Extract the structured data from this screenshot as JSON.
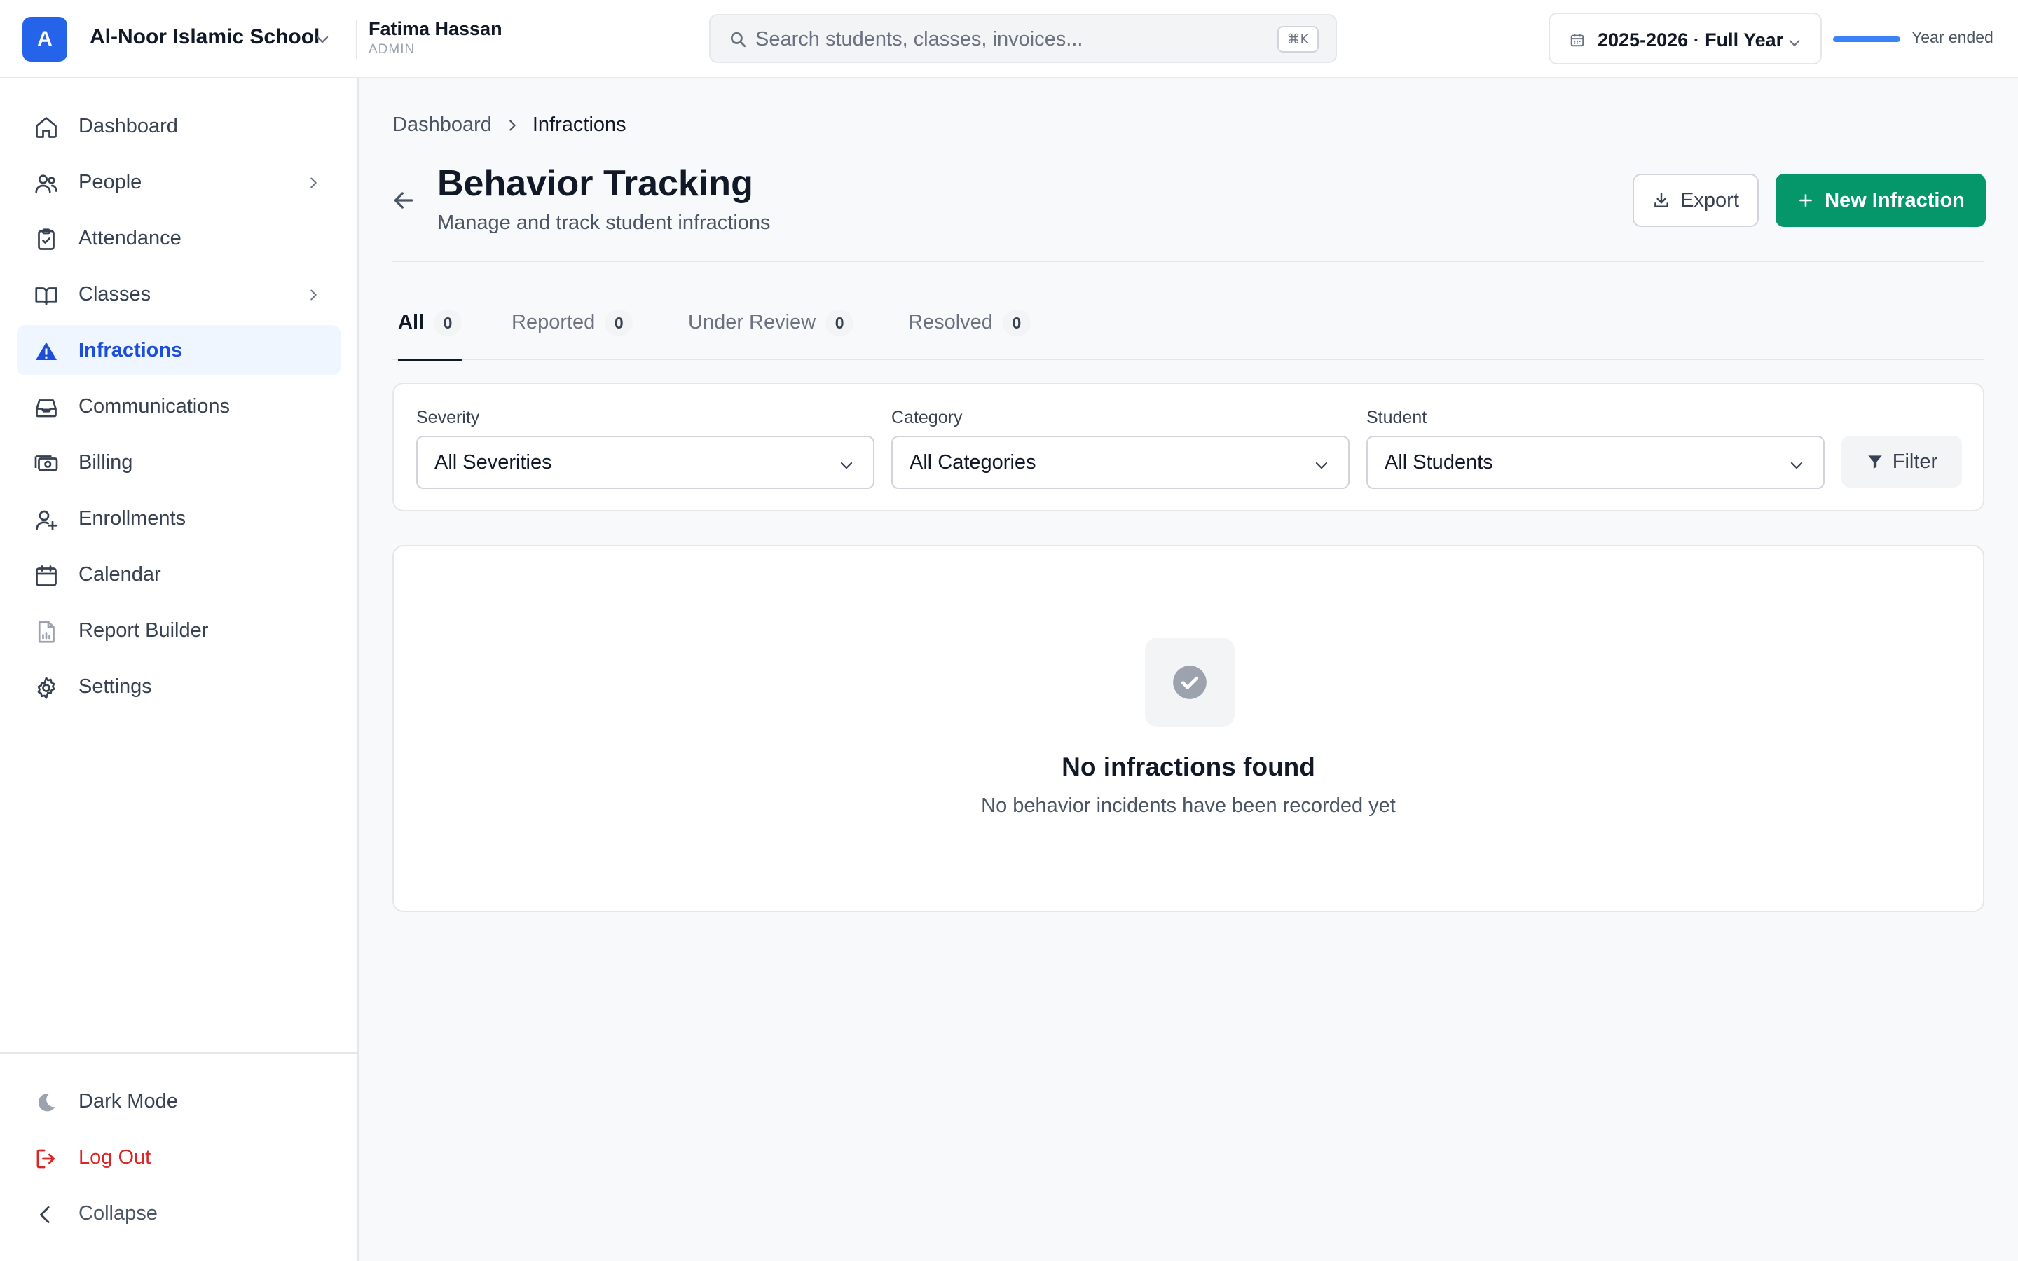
{
  "topbar": {
    "logo_letter": "A",
    "school_name": "Al-Noor Islamic School",
    "user_name": "Fatima Hassan",
    "user_role": "ADMIN",
    "search_placeholder": "Search students, classes, invoices...",
    "search_shortcut": "⌘K",
    "year_label": "2025-2026 · Full Year",
    "year_progress_percent": 100,
    "year_status": "Year ended"
  },
  "sidebar": {
    "items": [
      {
        "label": "Dashboard",
        "icon": "home-icon"
      },
      {
        "label": "People",
        "icon": "users-icon",
        "has_children": true
      },
      {
        "label": "Attendance",
        "icon": "clipboard-check-icon"
      },
      {
        "label": "Classes",
        "icon": "book-open-icon",
        "has_children": true
      },
      {
        "label": "Infractions",
        "icon": "warning-icon",
        "active": true
      },
      {
        "label": "Communications",
        "icon": "inbox-icon"
      },
      {
        "label": "Billing",
        "icon": "money-icon"
      },
      {
        "label": "Enrollments",
        "icon": "user-plus-icon"
      },
      {
        "label": "Calendar",
        "icon": "calendar-icon"
      },
      {
        "label": "Report Builder",
        "icon": "report-icon"
      },
      {
        "label": "Settings",
        "icon": "gear-icon"
      }
    ],
    "bottom": {
      "dark_mode": "Dark Mode",
      "logout": "Log Out",
      "collapse": "Collapse"
    }
  },
  "breadcrumb": {
    "root": "Dashboard",
    "current": "Infractions"
  },
  "header": {
    "title": "Behavior Tracking",
    "subtitle": "Manage and track student infractions",
    "export_label": "Export",
    "new_label": "New Infraction"
  },
  "tabs": [
    {
      "label": "All",
      "count": "0",
      "active": true
    },
    {
      "label": "Reported",
      "count": "0"
    },
    {
      "label": "Under Review",
      "count": "0"
    },
    {
      "label": "Resolved",
      "count": "0"
    }
  ],
  "filters": {
    "severity": {
      "label": "Severity",
      "value": "All Severities"
    },
    "category": {
      "label": "Category",
      "value": "All Categories"
    },
    "student": {
      "label": "Student",
      "value": "All Students"
    },
    "filter_button": "Filter"
  },
  "empty_state": {
    "title": "No infractions found",
    "description": "No behavior incidents have been recorded yet"
  },
  "colors": {
    "primary": "#2563eb",
    "success": "#059669",
    "danger": "#dc2626",
    "active_bg": "#eff6ff"
  }
}
